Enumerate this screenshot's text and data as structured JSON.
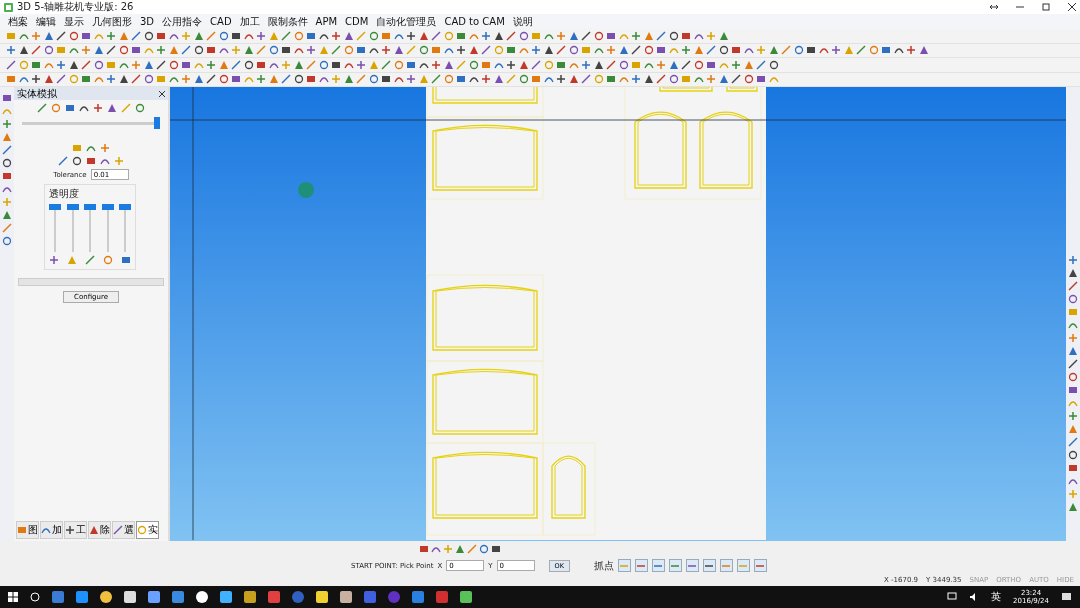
{
  "window": {
    "title": "3D 5-轴雕花机专业版: 26"
  },
  "menu": [
    "档案",
    "编辑",
    "显示",
    "几何图形",
    "3D",
    "公用指令",
    "CAD",
    "加工",
    "限制条件",
    "APM",
    "CDM",
    "自动化管理员",
    "CAD to CAM",
    "说明"
  ],
  "panel": {
    "title": "实体模拟",
    "timeline": {
      "level": 1
    },
    "tolerance": {
      "label": "Tolerance",
      "value": "0.01"
    },
    "transparency": {
      "title": "透明度",
      "sliders": [
        {
          "level": 1
        },
        {
          "level": 1
        },
        {
          "level": 1
        },
        {
          "level": 1
        },
        {
          "level": 1
        }
      ]
    },
    "progress": {
      "level": 0
    },
    "configure": "Configure",
    "tabs": [
      {
        "label": "图",
        "selected": false
      },
      {
        "label": "加",
        "selected": false
      },
      {
        "label": "工",
        "selected": false
      },
      {
        "label": "除",
        "selected": false
      },
      {
        "label": "選",
        "selected": false
      },
      {
        "label": "实",
        "selected": true
      }
    ]
  },
  "command": {
    "prompt": "START POINT: Pick Point",
    "x_label": "X",
    "x_value": "0",
    "y_label": "Y",
    "y_value": "0",
    "ok": "OK",
    "snap_label": "抓点"
  },
  "status": {
    "x": "X -1670.9",
    "y": "Y 3449.35",
    "modes": [
      "SNAP",
      "ORTHO",
      "AUTO",
      "HIDE"
    ]
  },
  "taskbar": {
    "ime": "英",
    "time": "23:24",
    "date": "2016/9/24"
  }
}
